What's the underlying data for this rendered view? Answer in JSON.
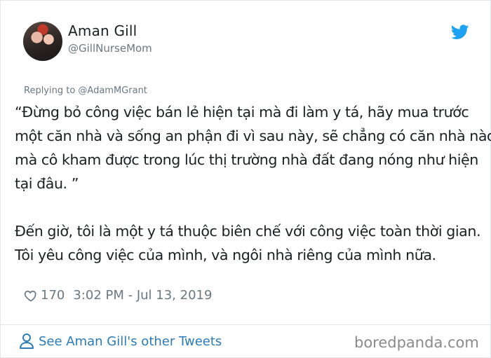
{
  "author": {
    "name": "Aman Gill",
    "handle": "@GillNurseMom",
    "avatar_icon": "profile-photo"
  },
  "brand": {
    "icon": "twitter-bird-icon",
    "color": "#1da1f2"
  },
  "tweet": {
    "replying_to": "Replying to @AdamMGrant",
    "paragraph1_lines": [
      "“Đừng bỏ công việc bán lẻ hiện tại mà đi làm y tá, hãy mua trước",
      "một căn nhà và sống an phận đi vì sau này, sẽ chẳng có căn nhà nào",
      "mà cô kham được trong lúc thị trường nhà đất đang nóng như hiện",
      "tại đâu. ”"
    ],
    "paragraph2_lines": [
      "Đến giờ, tôi là một y tá thuộc biên chế với công việc toàn thời gian.",
      "Tôi yêu công việc của mình, và ngôi nhà riêng của mình nữa."
    ],
    "likes": "170",
    "timestamp": "3:02 PM - Jul 13, 2019"
  },
  "footer": {
    "other_tweets_label": "See Aman Gill's other Tweets",
    "link_color": "#2b7bb9"
  },
  "watermark": "boredpanda.com"
}
